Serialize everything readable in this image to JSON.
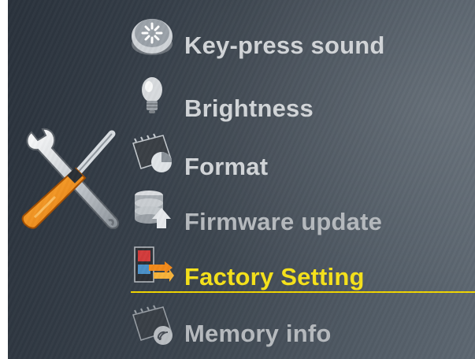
{
  "menu": {
    "items": [
      {
        "label": "Key-press sound",
        "icon": "speaker-button-icon",
        "state": "normal"
      },
      {
        "label": "Brightness",
        "icon": "light-bulb-icon",
        "state": "normal"
      },
      {
        "label": "Format",
        "icon": "memory-chip-pie-icon",
        "state": "normal"
      },
      {
        "label": "Firmware update",
        "icon": "database-upload-icon",
        "state": "dimmed"
      },
      {
        "label": "Factory Setting",
        "icon": "factory-reset-icon",
        "state": "selected"
      },
      {
        "label": "Memory info",
        "icon": "memory-chip-info-icon",
        "state": "dimmed"
      }
    ]
  },
  "colors": {
    "selected_text": "#f6e21a",
    "normal_text": "#d2d5d8",
    "dimmed_text": "#b6babe",
    "underline": "#f0d400"
  },
  "header_icon": "tools-icon"
}
